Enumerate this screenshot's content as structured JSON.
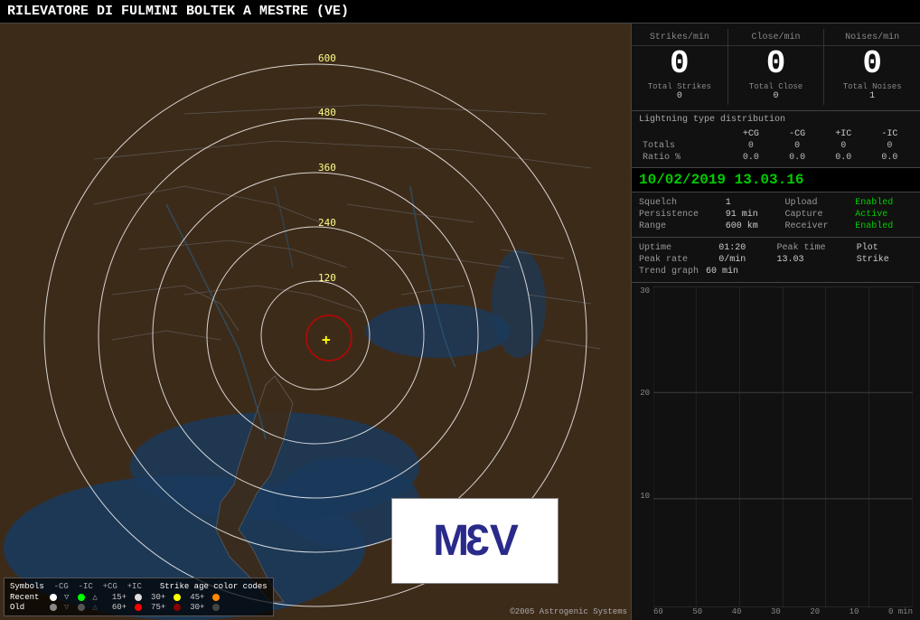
{
  "title": "RILEVATORE DI FULMINI BOLTEK A MESTRE (VE)",
  "stats": {
    "strikes_per_min_label": "Strikes/min",
    "close_per_min_label": "Close/min",
    "noises_per_min_label": "Noises/min",
    "strikes_per_min_value": "0",
    "close_per_min_value": "0",
    "noises_per_min_value": "0",
    "total_strikes_label": "Total Strikes",
    "total_close_label": "Total Close",
    "total_noises_label": "Total Noises",
    "total_strikes_value": "0",
    "total_close_value": "0",
    "total_noises_value": "1"
  },
  "lightning_dist": {
    "title": "Lightning type distribution",
    "cols": [
      "+CG",
      "-CG",
      "+IC",
      "-IC"
    ],
    "rows": [
      {
        "label": "Totals",
        "values": [
          "0",
          "0",
          "0",
          "0"
        ]
      },
      {
        "label": "Ratio %",
        "values": [
          "0.0",
          "0.0",
          "0.0",
          "0.0"
        ]
      }
    ]
  },
  "datetime": "10/02/2019 13.03.16",
  "info": {
    "squelch_label": "Squelch",
    "squelch_value": "1",
    "upload_label": "Upload",
    "upload_value": "Enabled",
    "persistence_label": "Persistence",
    "persistence_value": "91 min",
    "capture_label": "Capture",
    "capture_value": "Active",
    "range_label": "Range",
    "range_value": "600 km",
    "receiver_label": "Receiver",
    "receiver_value": "Enabled"
  },
  "uptime": {
    "uptime_label": "Uptime",
    "uptime_value": "01:20",
    "peak_time_label": "Peak time",
    "peak_time_value": "Plot",
    "peak_rate_label": "Peak rate",
    "peak_rate_value": "0/min",
    "peak_time2_value": "13.03",
    "peak_type_value": "Strike",
    "trend_label": "Trend graph",
    "trend_value": "60 min"
  },
  "chart": {
    "y_labels": [
      "30",
      "20",
      "10",
      ""
    ],
    "x_labels": [
      "60",
      "50",
      "40",
      "30",
      "20",
      "10",
      "0 min"
    ]
  },
  "legend": {
    "symbols_label": "Symbols",
    "neg_cg": "-CG",
    "neg_ic": "-IC",
    "pos_cg": "+CG",
    "pos_ic": "+IC",
    "age_label": "Strike age color codes",
    "recent_label": "Recent",
    "old_label": "Old",
    "age_rows": [
      {
        "label": "15+",
        "color": "#aaaaaa"
      },
      {
        "label": "30+",
        "color": "#ffff00"
      },
      {
        "label": "45+",
        "color": "#ff8800"
      }
    ],
    "age_rows2": [
      {
        "label": "60+",
        "color": "#ff0000"
      },
      {
        "label": "75+",
        "color": "#880000"
      },
      {
        "label": "30+",
        "color": "#444444"
      }
    ]
  },
  "copyright": "©2005 Astrogenic Systems",
  "map": {
    "range_labels": [
      "600",
      "480",
      "360",
      "240",
      "120"
    ],
    "center_label": "+"
  }
}
